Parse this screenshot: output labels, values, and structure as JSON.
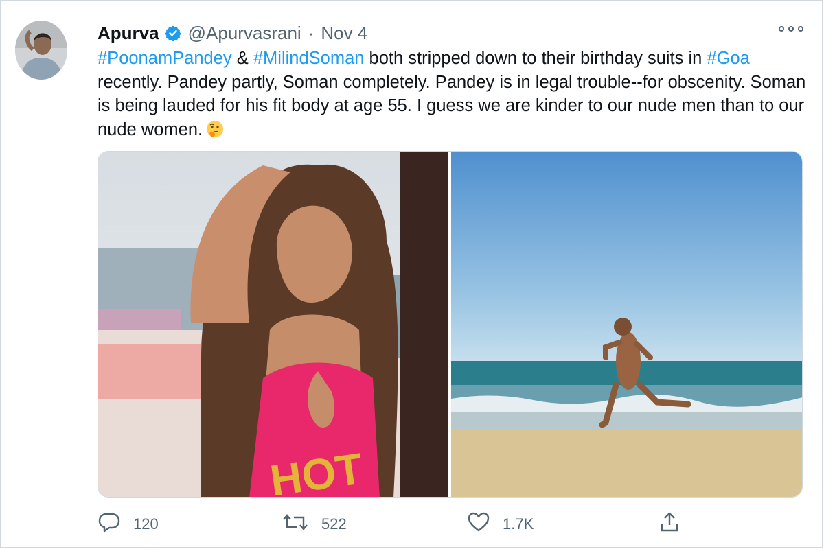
{
  "author": {
    "name": "Apurva",
    "handle": "@Apurvasrani",
    "date": "Nov 4",
    "avatar_icon": "profile-photo"
  },
  "tweet": {
    "tag1": "#PoonamPandey",
    "amp": "&",
    "tag2": "#MilindSoman",
    "text1": "both stripped down to their birthday suits in",
    "tag3": "#Goa",
    "text2": "recently. Pandey partly, Soman completely. Pandey is in legal trouble--for obscenity. Soman is being lauded for his fit body at age 55. I guess we are kinder to our nude men than to our nude women.",
    "emoji_icon": "thinking-face"
  },
  "media": {
    "left_photo": "woman-beach-photo",
    "right_photo": "man-running-beach-photo",
    "swimsuit_text": "HOT"
  },
  "actions": {
    "reply_count": "120",
    "retweet_count": "522",
    "like_count": "1.7K"
  },
  "colors": {
    "link": "#1d9bf0",
    "muted": "#536471",
    "verified": "#1d9bf0"
  }
}
